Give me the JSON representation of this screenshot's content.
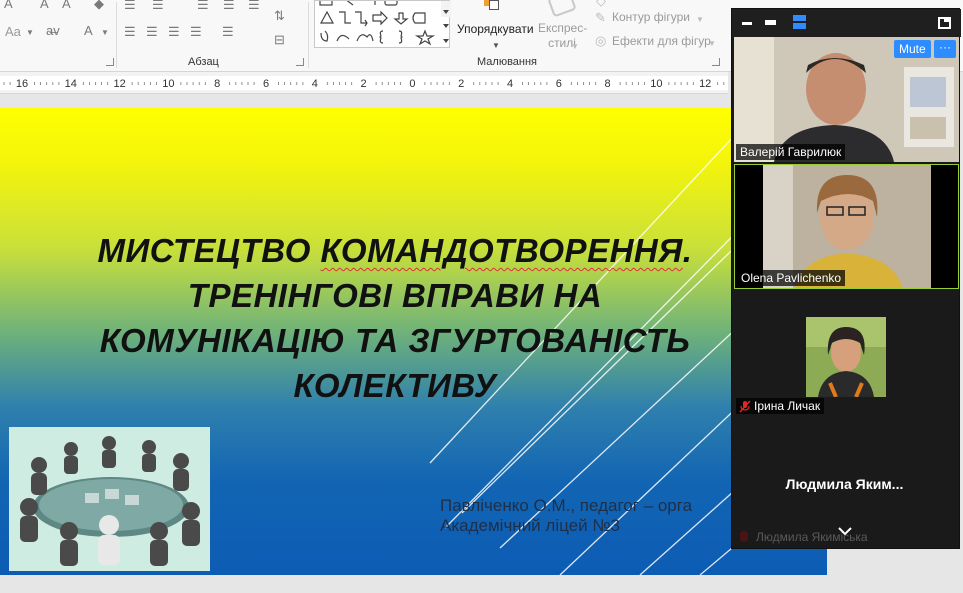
{
  "ribbon": {
    "font_size_label": "Aa",
    "paragraph_group": "Абзац",
    "drawing_group": "Малювання",
    "arrange": "Упорядкувати",
    "express_styles": "Експрес-\nстилі",
    "shape_outline": "Контур фігури",
    "shape_effects": "Ефекти для фігур"
  },
  "ruler": {
    "ticks": [
      "16",
      "14",
      "12",
      "10",
      "8",
      "6",
      "4",
      "2",
      "0",
      "2",
      "4",
      "6",
      "8",
      "10",
      "12"
    ]
  },
  "slide": {
    "title_part1": "МИСТЕЦТВО ",
    "title_spell": "КОМАНДОТВОРЕННЯ",
    "title_part2": ".",
    "title_line2": "ТРЕНІНГОВІ ВПРАВИ НА",
    "title_line3": "КОМУНІКАЦІЮ ТА ЗГУРТОВАНІСТЬ",
    "title_line4": "КОЛЕКТИВУ",
    "author_line1": "Павліченко О.М., педагог – орга",
    "author_line2": "Академічний ліцей №3"
  },
  "zoom": {
    "mute_label": "Mute",
    "more_label": "···",
    "participants": [
      {
        "name": "Валерій Гаврилюк"
      },
      {
        "name": "Olena Pavlichenko"
      },
      {
        "name": "Ірина Личак"
      }
    ],
    "big_name": "Людмила  Яким...",
    "faded_name": "Людмила Якимiська"
  },
  "colors": {
    "zoom_blue": "#2d8cff",
    "active_speaker": "#9acd32",
    "slide_yellow": "#ffff00",
    "slide_blue": "#0c5cb4"
  }
}
